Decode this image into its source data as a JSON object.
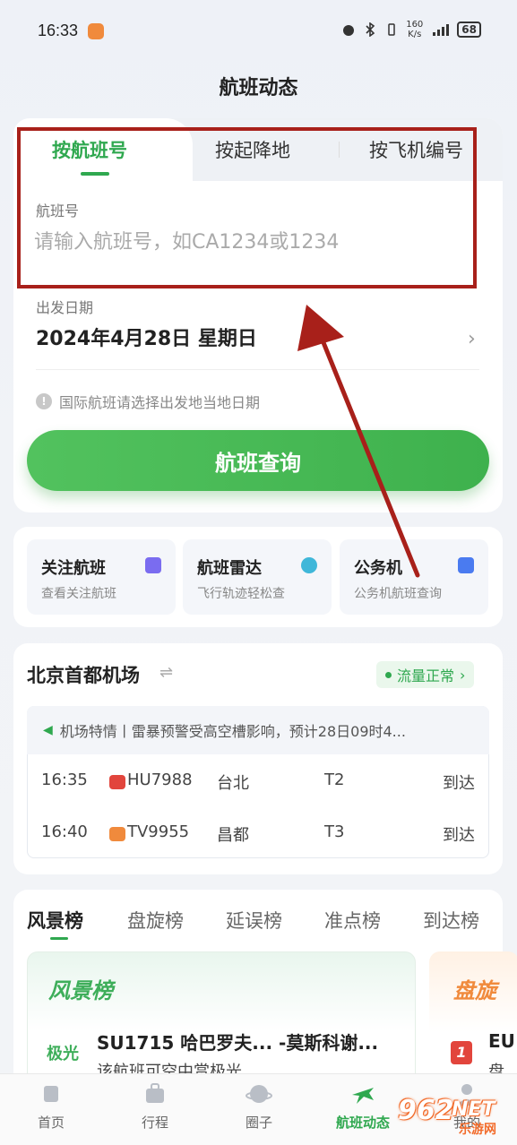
{
  "status_bar": {
    "time": "16:33",
    "net_speed_value": "160",
    "net_speed_unit": "K/s",
    "signal": "5G",
    "battery": "68"
  },
  "header": {
    "title": "航班动态"
  },
  "search": {
    "tabs": [
      {
        "label": "按航班号",
        "active": true
      },
      {
        "label": "按起降地",
        "active": false
      },
      {
        "label": "按飞机编号",
        "active": false
      }
    ],
    "flight_label": "航班号",
    "flight_placeholder": "请输入航班号，如CA1234或1234",
    "date_label": "出发日期",
    "date_value": "2024年4月28日 星期日",
    "tip": "国际航班请选择出发地当地日期",
    "query_button": "航班查询"
  },
  "quick_links": [
    {
      "title": "关注航班",
      "subtitle": "查看关注航班",
      "icon": "ticket-icon",
      "color": "#7a6cf0"
    },
    {
      "title": "航班雷达",
      "subtitle": "飞行轨迹轻松查",
      "icon": "radar-icon",
      "color": "#3fb7d9"
    },
    {
      "title": "公务机",
      "subtitle": "公务机航班查询",
      "icon": "search-icon",
      "color": "#4a7bf0"
    }
  ],
  "airport": {
    "name": "北京首都机场",
    "traffic_status": "流量正常",
    "notice": "机场特情丨雷暴预警受高空槽影响，预计28日09时4...",
    "flights": [
      {
        "time": "16:35",
        "flight_no": "HU7988",
        "city": "台北",
        "terminal": "T2",
        "status": "到达",
        "airline_color": "#e2453c"
      },
      {
        "time": "16:40",
        "flight_no": "TV9955",
        "city": "昌都",
        "terminal": "T3",
        "status": "到达",
        "airline_color": "#f08a3c"
      }
    ]
  },
  "rankings": {
    "tabs": [
      "风景榜",
      "盘旋榜",
      "延误榜",
      "准点榜",
      "到达榜"
    ],
    "panel1": {
      "title": "风景榜",
      "tag": "极光",
      "flight": "SU1715 哈巴罗夫... -莫斯科谢...",
      "desc": "该航班可空中赏极光"
    },
    "panel2": {
      "title": "盘旋",
      "rank": "1",
      "flight": "EU",
      "desc": "盘"
    }
  },
  "bottom_nav": [
    {
      "label": "首页",
      "active": false
    },
    {
      "label": "行程",
      "active": false
    },
    {
      "label": "圈子",
      "active": false
    },
    {
      "label": "航班动态",
      "active": true
    },
    {
      "label": "我的",
      "active": false
    }
  ],
  "watermark": {
    "number": "962",
    "suffix": "NET",
    "site": "乐游网"
  },
  "colors": {
    "accent": "#2fa84f",
    "highlight": "#a8201a"
  }
}
